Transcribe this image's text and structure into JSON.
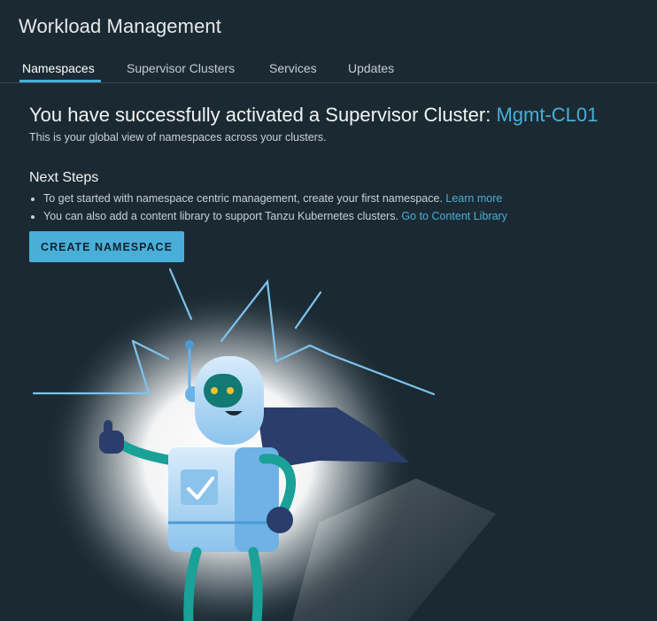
{
  "page": {
    "title": "Workload Management"
  },
  "tabs": [
    {
      "label": "Namespaces",
      "active": true
    },
    {
      "label": "Supervisor Clusters",
      "active": false
    },
    {
      "label": "Services",
      "active": false
    },
    {
      "label": "Updates",
      "active": false
    }
  ],
  "hero": {
    "headline_prefix": "You have successfully activated a Supervisor Cluster: ",
    "cluster_name": "Mgmt-CL01",
    "subtitle": "This is your global view of namespaces across your clusters."
  },
  "next_steps": {
    "heading": "Next Steps",
    "items": [
      {
        "text": "To get started with namespace centric management, create your first namespace. ",
        "link": "Learn more"
      },
      {
        "text": "You can also add a content library to support Tanzu Kubernetes clusters. ",
        "link": "Go to Content Library"
      }
    ]
  },
  "actions": {
    "create_namespace": "CREATE NAMESPACE"
  },
  "colors": {
    "background": "#1b2a32",
    "accent": "#49afd9",
    "robot_body": "#a9d4f3",
    "robot_face": "#127a72",
    "cape": "#2a3d6b"
  }
}
